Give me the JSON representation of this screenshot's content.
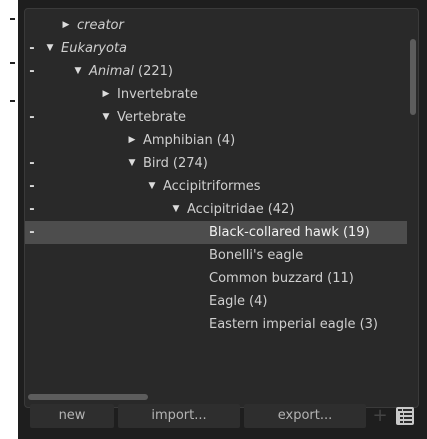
{
  "tree": {
    "rows": [
      {
        "dash": "",
        "toggle": "▶",
        "label": "creator",
        "count": "",
        "italic": true,
        "selected": false
      },
      {
        "dash": "-",
        "toggle": "▼",
        "label": "Eukaryota",
        "count": "",
        "italic": true,
        "selected": false
      },
      {
        "dash": "-",
        "toggle": "▼",
        "label": "Animal",
        "count": "(221)",
        "italic": true,
        "selected": false
      },
      {
        "dash": "",
        "toggle": "▶",
        "label": "Invertebrate",
        "count": "",
        "italic": false,
        "selected": false
      },
      {
        "dash": "-",
        "toggle": "▼",
        "label": "Vertebrate",
        "count": "",
        "italic": false,
        "selected": false
      },
      {
        "dash": "",
        "toggle": "▶",
        "label": "Amphibian",
        "count": "(4)",
        "italic": false,
        "selected": false
      },
      {
        "dash": "-",
        "toggle": "▼",
        "label": "Bird",
        "count": "(274)",
        "italic": false,
        "selected": false
      },
      {
        "dash": "-",
        "toggle": "▼",
        "label": "Accipitriformes",
        "count": "",
        "italic": false,
        "selected": false
      },
      {
        "dash": "-",
        "toggle": "▼",
        "label": "Accipitridae",
        "count": "(42)",
        "italic": false,
        "selected": false
      },
      {
        "dash": "-",
        "toggle": "",
        "label": "Black-collared hawk",
        "count": "(19)",
        "italic": false,
        "selected": true
      },
      {
        "dash": "",
        "toggle": "",
        "label": "Bonelli's eagle",
        "count": "",
        "italic": false,
        "selected": false
      },
      {
        "dash": "",
        "toggle": "",
        "label": "Common buzzard",
        "count": "(11)",
        "italic": false,
        "selected": false
      },
      {
        "dash": "",
        "toggle": "",
        "label": "Eagle",
        "count": "(4)",
        "italic": false,
        "selected": false
      },
      {
        "dash": "",
        "toggle": "",
        "label": "Eastern imperial eagle",
        "count": "(3)",
        "italic": false,
        "selected": false
      }
    ]
  },
  "toolbar": {
    "new_label": "new",
    "import_label": "import...",
    "export_label": "export...",
    "plus_icon": "+",
    "tree_view_icon": "tree-view-icon"
  }
}
